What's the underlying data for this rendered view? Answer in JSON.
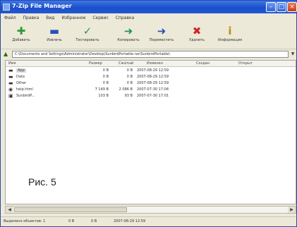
{
  "window": {
    "title": "7-Zip File Manager"
  },
  "menu": [
    "Файл",
    "Правка",
    "Вид",
    "Избранное",
    "Сервис",
    "Справка"
  ],
  "toolbar": [
    {
      "label": "Добавить",
      "icon": "add-icon",
      "glyph": "✚",
      "color": "#2e9a3a"
    },
    {
      "label": "Извлечь",
      "icon": "extract-icon",
      "glyph": "▬",
      "color": "#2a4fb8"
    },
    {
      "label": "Тестировать",
      "icon": "test-icon",
      "glyph": "✓",
      "color": "#3e8a6a"
    },
    {
      "label": "Копировать",
      "icon": "copy-icon",
      "glyph": "➜",
      "color": "#1f8f63"
    },
    {
      "label": "Переместить",
      "icon": "move-icon",
      "glyph": "➜",
      "color": "#2a4fb8"
    },
    {
      "label": "Удалить",
      "icon": "delete-icon",
      "glyph": "✖",
      "color": "#d02626"
    },
    {
      "label": "Информация",
      "icon": "info-icon",
      "glyph": "i",
      "color": "#b8900f"
    }
  ],
  "address": {
    "path": "C:\\Documents and Settings\\Administrator\\Desktop\\SunbirdPortable.rar\\SunbirdPortable\\"
  },
  "columns": [
    "Имя",
    "Размер",
    "Сжатый",
    "Изменен",
    "Создан",
    "Открыт"
  ],
  "files": [
    {
      "name": "App",
      "size": "0 B",
      "packed": "0 B",
      "modified": "2007-08-29 12:59",
      "type": "folder",
      "selected": true
    },
    {
      "name": "Data",
      "size": "0 B",
      "packed": "0 B",
      "modified": "2007-08-29 12:59",
      "type": "folder",
      "selected": false
    },
    {
      "name": "Other",
      "size": "0 B",
      "packed": "0 B",
      "modified": "2007-08-29 12:59",
      "type": "folder",
      "selected": false
    },
    {
      "name": "help.html",
      "size": "7 149 B",
      "packed": "2 086 B",
      "modified": "2007-07-30 17:04",
      "type": "file",
      "selected": false
    },
    {
      "name": "SunbirdP...",
      "size": "103 B",
      "packed": "93 B",
      "modified": "2007-07-30 17:01",
      "type": "exe",
      "selected": false
    }
  ],
  "caption": "Рис. 5",
  "status": {
    "selected": "Выделено объектов: 1",
    "size": "0 B",
    "packed": "0 B",
    "date": "2007-08-29 12:59"
  }
}
